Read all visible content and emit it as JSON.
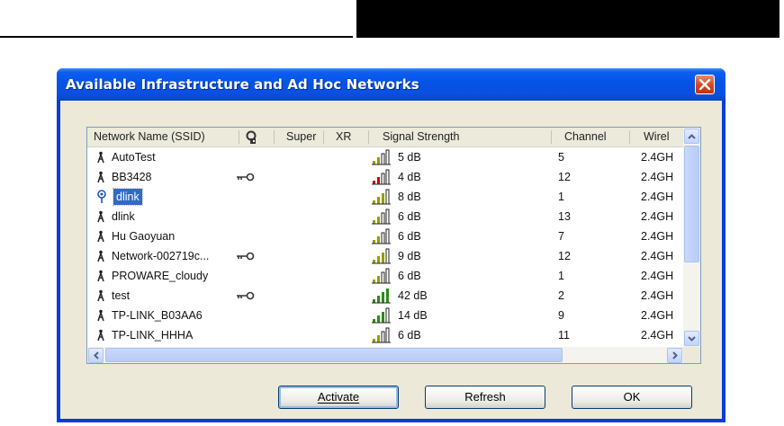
{
  "window": {
    "title": "Available Infrastructure and Ad Hoc Networks"
  },
  "columns": {
    "ssid": "Network Name (SSID)",
    "super": "Super",
    "xr": "XR",
    "signal": "Signal Strength",
    "channel": "Channel",
    "wireless": "Wirel"
  },
  "networks": [
    {
      "ssid": "AutoTest",
      "secured": false,
      "signal": "5 dB",
      "channel": "5",
      "band": "2.4GH",
      "bars": 2,
      "bar_color": "#9a9a00"
    },
    {
      "ssid": "BB3428",
      "secured": true,
      "signal": "4 dB",
      "channel": "12",
      "band": "2.4GH",
      "bars": 2,
      "bar_color": "#d00000"
    },
    {
      "ssid": "dlink",
      "secured": false,
      "signal": "8 dB",
      "channel": "1",
      "band": "2.4GH",
      "bars": 3,
      "bar_color": "#9a9a00",
      "selected": true,
      "adhoc": true
    },
    {
      "ssid": "dlink",
      "secured": false,
      "signal": "6 dB",
      "channel": "13",
      "band": "2.4GH",
      "bars": 2,
      "bar_color": "#9a9a00"
    },
    {
      "ssid": "Hu Gaoyuan",
      "secured": false,
      "signal": "6 dB",
      "channel": "7",
      "band": "2.4GH",
      "bars": 2,
      "bar_color": "#9a9a00"
    },
    {
      "ssid": "Network-002719c...",
      "secured": true,
      "signal": "9 dB",
      "channel": "12",
      "band": "2.4GH",
      "bars": 3,
      "bar_color": "#9a9a00"
    },
    {
      "ssid": "PROWARE_cloudy",
      "secured": false,
      "signal": "6 dB",
      "channel": "1",
      "band": "2.4GH",
      "bars": 2,
      "bar_color": "#9a9a00"
    },
    {
      "ssid": "test",
      "secured": true,
      "signal": "42 dB",
      "channel": "2",
      "band": "2.4GH",
      "bars": 4,
      "bar_color": "#2d8a1a"
    },
    {
      "ssid": "TP-LINK_B03AA6",
      "secured": false,
      "signal": "14 dB",
      "channel": "9",
      "band": "2.4GH",
      "bars": 3,
      "bar_color": "#2d8a1a"
    },
    {
      "ssid": "TP-LINK_HHHA",
      "secured": false,
      "signal": "6 dB",
      "channel": "11",
      "band": "2.4GH",
      "bars": 2,
      "bar_color": "#9a9a00"
    }
  ],
  "buttons": {
    "activate": "Activate",
    "refresh": "Refresh",
    "ok": "OK"
  },
  "icons": {
    "infrastructure": "tower-icon",
    "adhoc": "adhoc-icon",
    "security": "key-icon",
    "close": "close-icon"
  }
}
